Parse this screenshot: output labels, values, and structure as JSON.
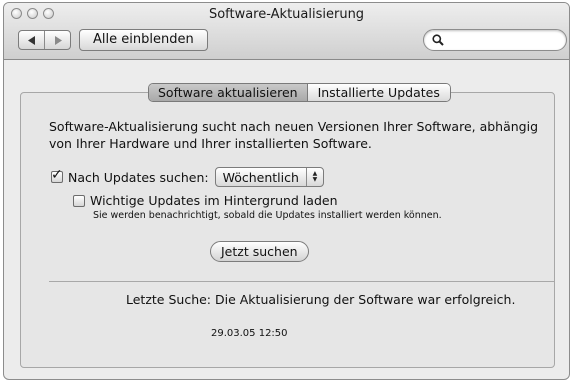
{
  "window": {
    "title": "Software-Aktualisierung"
  },
  "toolbar": {
    "back_icon": "chevron-left-icon",
    "forward_icon": "chevron-right-icon",
    "show_all_label": "Alle einblenden",
    "search": {
      "value": "",
      "placeholder": "",
      "icon": "search-icon"
    }
  },
  "tabs": [
    {
      "label": "Software aktualisieren",
      "selected": true
    },
    {
      "label": "Installierte Updates",
      "selected": false
    }
  ],
  "content": {
    "description": "Software-Aktualisierung sucht nach neuen Versionen Ihrer Software, abhängig von Ihrer Hardware und Ihrer installierten Software.",
    "check_updates": {
      "label": "Nach Updates suchen:",
      "checked": true
    },
    "frequency": {
      "selected": "Wöchentlich"
    },
    "background_download": {
      "label": "Wichtige Updates im Hintergrund laden",
      "checked": false
    },
    "background_note": "Sie werden benachrichtigt, sobald die Updates installiert werden können.",
    "check_now_label": "Jetzt suchen",
    "last_check": "Letzte Suche: Die Aktualisierung der Software war erfolgreich.",
    "last_check_date": "29.03.05 12:50"
  }
}
